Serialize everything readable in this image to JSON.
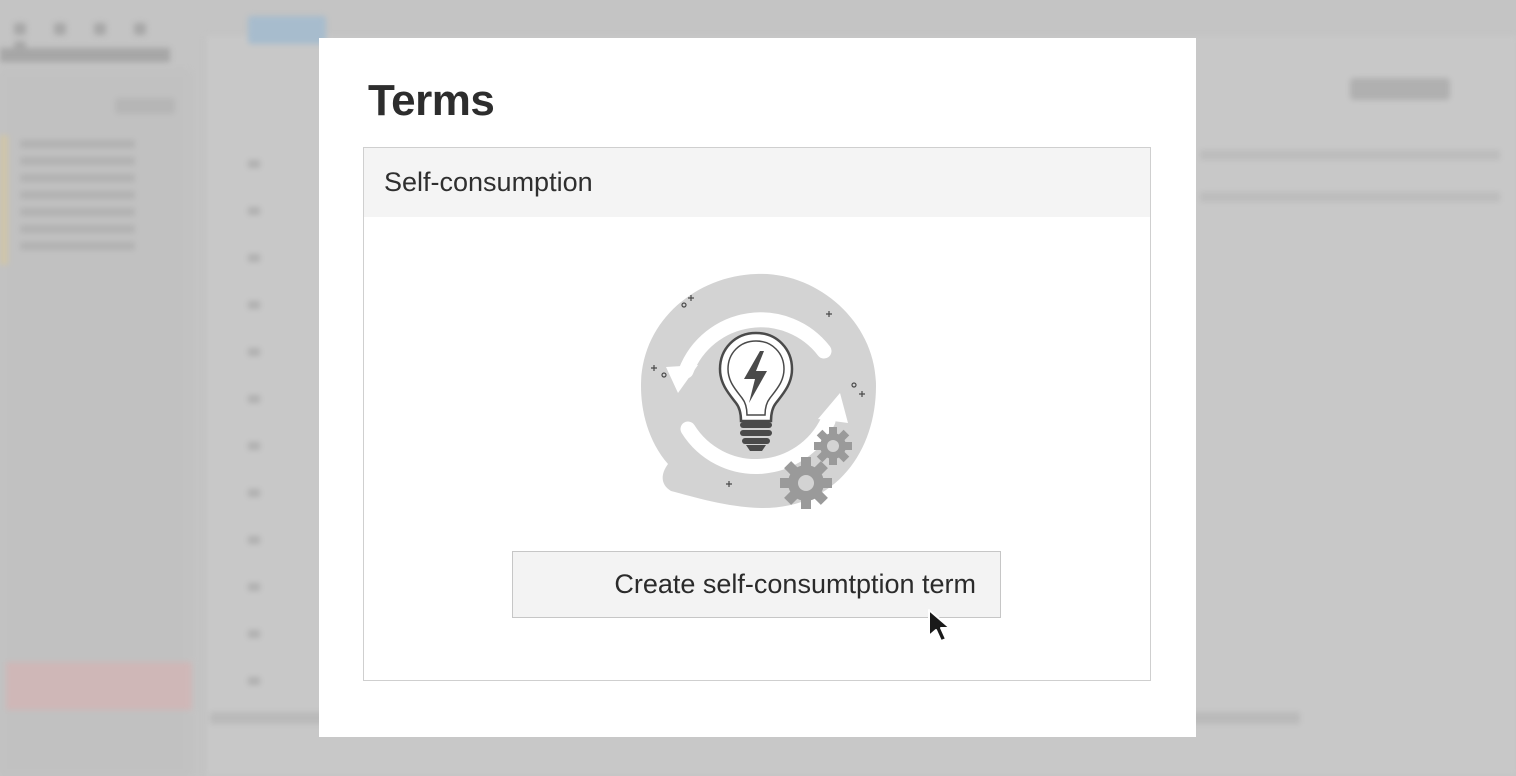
{
  "modal": {
    "title": "Terms",
    "section_title": "Self-consumption",
    "create_button_label": "Create self-consumtption term",
    "illustration_icon": "lightbulb-cycle-gears-icon"
  },
  "cursor": {
    "icon": "mouse-pointer-icon"
  },
  "colors": {
    "overlay": "#c4c4c4",
    "modal_bg": "#ffffff",
    "panel_header_bg": "#f4f4f4",
    "button_bg": "#f3f3f3",
    "illustration_blob": "#d3d3d3",
    "illustration_dark": "#4a4a4a"
  }
}
